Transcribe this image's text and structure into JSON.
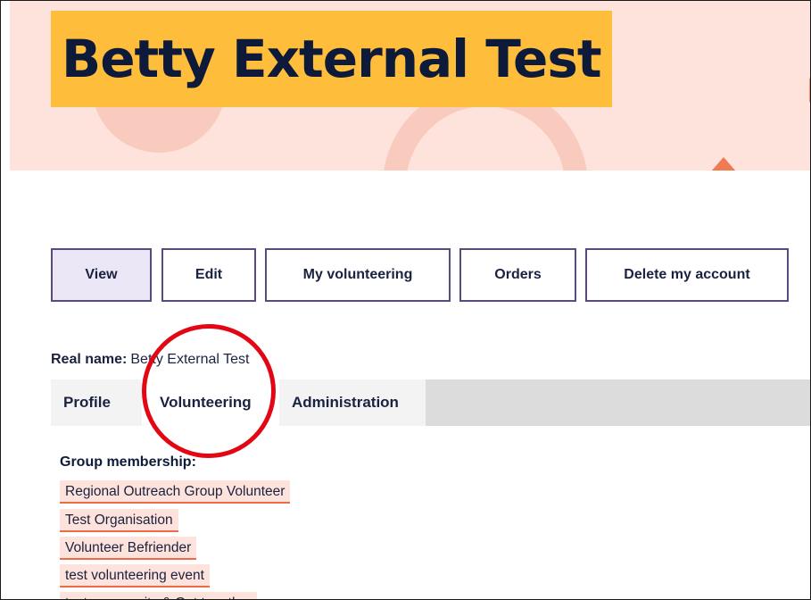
{
  "page_title": "Betty External Test",
  "local_tasks": [
    {
      "label": "View",
      "active": true
    },
    {
      "label": "Edit",
      "active": false
    },
    {
      "label": "My volunteering",
      "active": false
    },
    {
      "label": "Orders",
      "active": false
    },
    {
      "label": "Delete my account",
      "active": false
    }
  ],
  "real_name": {
    "label": "Real name:",
    "value": "Betty External Test"
  },
  "tabs": [
    {
      "label": "Profile",
      "active": false
    },
    {
      "label": "Volunteering",
      "active": true
    },
    {
      "label": "Administration",
      "active": false
    }
  ],
  "group_membership": {
    "heading": "Group membership:",
    "items": [
      "Regional Outreach Group Volunteer",
      "Test Organisation",
      "Volunteer Befriender",
      "test volunteering event",
      "test community & Get together"
    ]
  },
  "colors": {
    "hero_bg": "#fde3dc",
    "title_highlight": "#ffbd3c",
    "task_border": "#5b4a7e",
    "link_underline": "#ef6a46",
    "annotation": "#e30613"
  }
}
